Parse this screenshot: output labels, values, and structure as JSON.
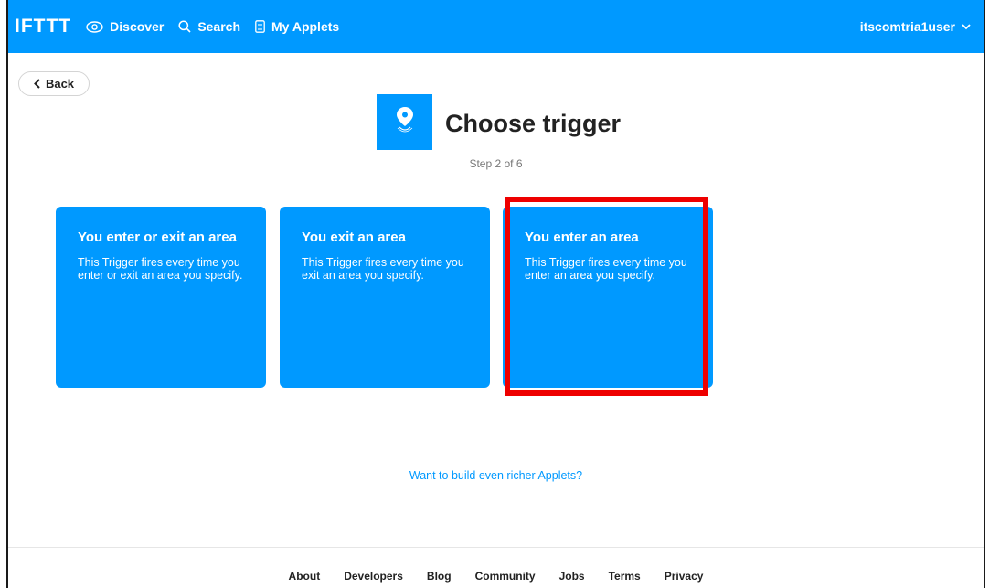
{
  "nav": {
    "logo": "IFTTT",
    "items": [
      {
        "label": "Discover",
        "icon": "eye-icon"
      },
      {
        "label": "Search",
        "icon": "search-icon"
      },
      {
        "label": "My Applets",
        "icon": "document-icon"
      }
    ],
    "user": "itscomtria1user"
  },
  "back_label": "Back",
  "page": {
    "title": "Choose trigger",
    "step": "Step 2 of 6",
    "service_icon": "location-pin-icon"
  },
  "triggers": [
    {
      "title": "You enter or exit an area",
      "description": "This Trigger fires every time you enter or exit an area you specify."
    },
    {
      "title": "You exit an area",
      "description": "This Trigger fires every time you exit an area you specify."
    },
    {
      "title": "You enter an area",
      "description": "This Trigger fires every time you enter an area you specify."
    }
  ],
  "richer_link": "Want to build even richer Applets?",
  "footer": [
    "About",
    "Developers",
    "Blog",
    "Community",
    "Jobs",
    "Terms",
    "Privacy"
  ],
  "colors": {
    "brand": "#0099ff",
    "highlight": "#ee0000"
  }
}
